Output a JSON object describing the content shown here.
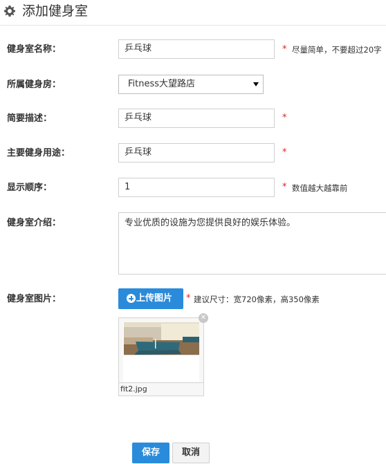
{
  "page": {
    "title": "添加健身室",
    "icon": "gear-icon"
  },
  "form": {
    "name": {
      "label": "健身室名称：",
      "value": "乒乓球",
      "required": "*",
      "hint": "尽量简单，不要超过20字"
    },
    "gym": {
      "label": "所属健身房：",
      "selected": "Fitness大望路店"
    },
    "brief": {
      "label": "简要描述：",
      "value": "乒乓球",
      "required": "*"
    },
    "usage": {
      "label": "主要健身用途：",
      "value": "乒乓球",
      "required": "*"
    },
    "order": {
      "label": "显示顺序：",
      "value": "1",
      "required": "*",
      "hint": "数值越大越靠前"
    },
    "intro": {
      "label": "健身室介绍：",
      "value": "专业优质的设施为您提供良好的娱乐体验。"
    },
    "image": {
      "label": "健身室图片：",
      "upload_label": "上传图片",
      "required": "*",
      "hint": "建议尺寸：宽720像素，高350像素",
      "file_name": "fit2.jpg",
      "remove_icon": "close-icon"
    }
  },
  "actions": {
    "save_label": "保存",
    "cancel_label": "取消"
  },
  "colors": {
    "primary": "#2a8bdb",
    "required": "#e02020"
  }
}
